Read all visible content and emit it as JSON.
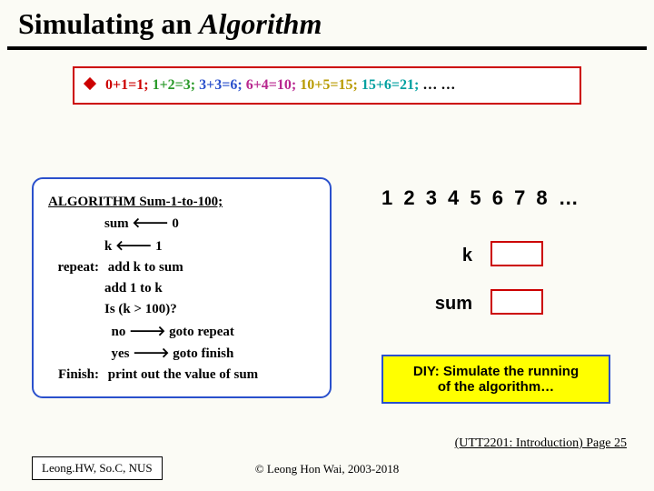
{
  "title": {
    "prefix": "Simulating an ",
    "emph": "Algorithm"
  },
  "calc": {
    "eq1": "0+1=1;",
    "eq2": "1+2=3;",
    "eq3": "3+3=6;",
    "eq4": "6+4=10;",
    "eq5": "10+5=15;",
    "eq6": "15+6=21;",
    "tail": " … …"
  },
  "algo": {
    "header": "ALGORITHM Sum-1-to-100;",
    "l1a": "sum ",
    "l1b": " 0",
    "l2a": "k ",
    "l2b": " 1",
    "repeat_label": "repeat:",
    "l3": "add k to sum",
    "l4": "add 1 to k",
    "l5": "Is (k > 100)?",
    "l6a": "no ",
    "l6b": " goto repeat",
    "l7a": "yes ",
    "l7b": " goto finish",
    "finish_label": "Finish:",
    "l8": "print out the value of sum"
  },
  "right": {
    "numline": "1  2  3  4  5  6  7  8 …",
    "k_label": "k",
    "sum_label": "sum",
    "diy_l1": "DIY: Simulate the running",
    "diy_l2": "of the algorithm…"
  },
  "footer": {
    "right": "(UTT2201: Introduction) Page 25",
    "center": "© Leong Hon Wai, 2003-2018",
    "left": "Leong.HW, So.C, NUS"
  }
}
